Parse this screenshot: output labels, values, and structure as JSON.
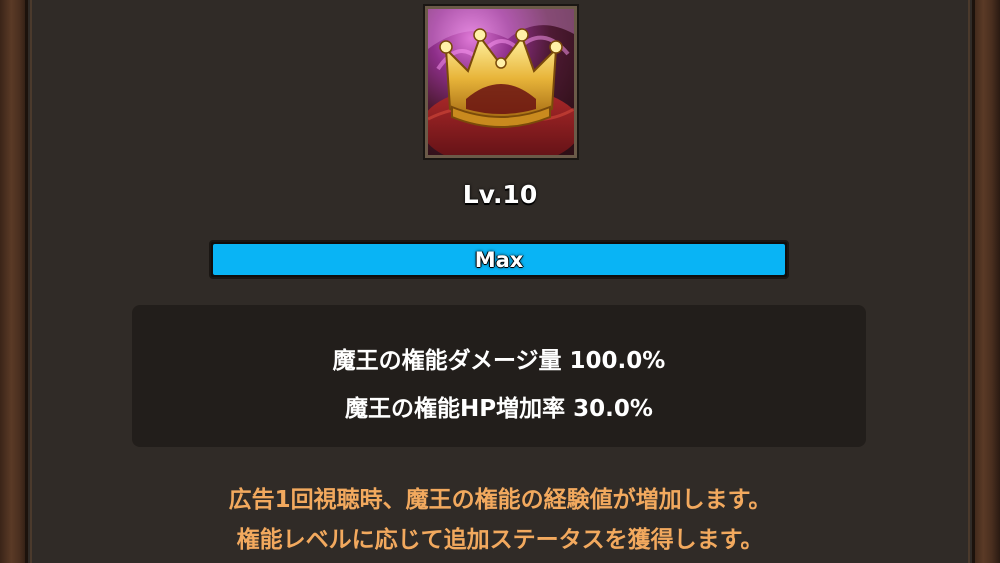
{
  "skill": {
    "icon": "crown-icon",
    "level": "Lv.10",
    "progress_label": "Max",
    "progress_fraction": 1.0
  },
  "stats": [
    "魔王の権能ダメージ量 100.0%",
    "魔王の権能HP増加率 30.0%"
  ],
  "notes": [
    "広告1回視聴時、魔王の権能の経験値が増加します。",
    "権能レベルに応じて追加ステータスを獲得します。"
  ],
  "colors": {
    "bar_fill": "#09b4f5",
    "note_text": "#f2a95e"
  }
}
